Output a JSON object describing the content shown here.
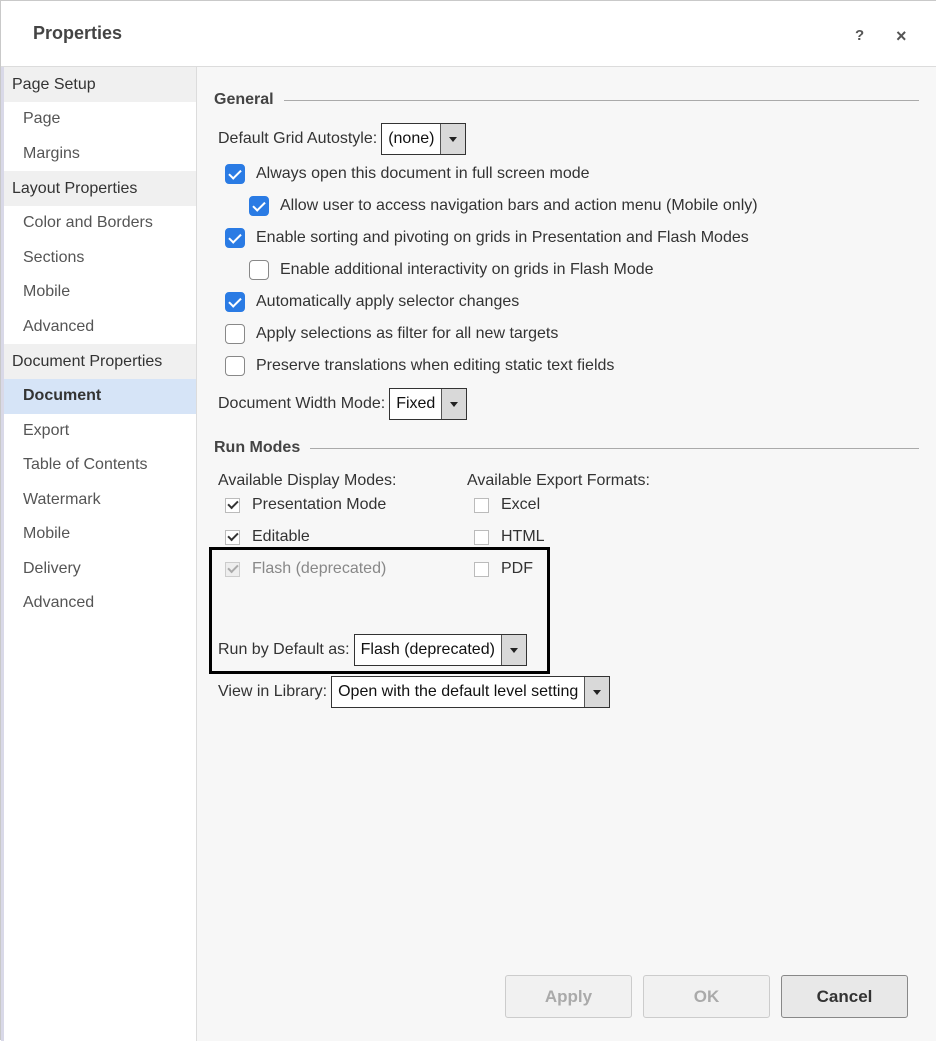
{
  "window": {
    "title": "Properties",
    "help_glyph": "?",
    "close_glyph": "×"
  },
  "sidebar": {
    "groups": [
      {
        "label": "Page Setup",
        "items": [
          "Page",
          "Margins"
        ]
      },
      {
        "label": "Layout Properties",
        "items": [
          "Color and Borders",
          "Sections",
          "Mobile",
          "Advanced"
        ]
      },
      {
        "label": "Document Properties",
        "items": [
          "Document",
          "Export",
          "Table of Contents",
          "Watermark",
          "Mobile",
          "Delivery",
          "Advanced"
        ]
      }
    ],
    "active_item": "Document"
  },
  "general": {
    "heading": "General",
    "grid_autostyle_label": "Default Grid Autostyle:",
    "grid_autostyle_value": "(none)",
    "full_screen": {
      "label": "Always open this document in full screen mode",
      "checked": true
    },
    "nav_bars": {
      "label": "Allow user to access navigation bars and action menu (Mobile only)",
      "checked": true
    },
    "sorting": {
      "label": "Enable sorting and pivoting on grids in Presentation and Flash Modes",
      "checked": true
    },
    "interactivity": {
      "label": "Enable additional interactivity on grids in Flash Mode",
      "checked": false
    },
    "auto_selector": {
      "label": "Automatically apply selector changes",
      "checked": true
    },
    "apply_filter": {
      "label": "Apply selections as filter for all new targets",
      "checked": false
    },
    "preserve_translations": {
      "label": "Preserve translations when editing static text fields",
      "checked": false
    },
    "width_mode_label": "Document Width Mode:",
    "width_mode_value": "Fixed"
  },
  "run_modes": {
    "heading": "Run Modes",
    "display_modes_label": "Available Display Modes:",
    "export_formats_label": "Available Export Formats:",
    "display_modes": [
      {
        "label": "Presentation Mode",
        "checked": true,
        "disabled": false
      },
      {
        "label": "Editable",
        "checked": true,
        "disabled": false
      },
      {
        "label": "Flash (deprecated)",
        "checked": true,
        "disabled": true
      }
    ],
    "export_formats": [
      {
        "label": "Excel",
        "checked": false
      },
      {
        "label": "HTML",
        "checked": false
      },
      {
        "label": "PDF",
        "checked": false
      }
    ],
    "run_default_label": "Run by Default as:",
    "run_default_value": "Flash (deprecated)",
    "view_library_label": "View in Library:",
    "view_library_value": "Open with the default level setting"
  },
  "buttons": {
    "apply": "Apply",
    "ok": "OK",
    "cancel": "Cancel"
  },
  "colors": {
    "accent": "#2a7be4",
    "active_nav": "#d6e4f7"
  }
}
